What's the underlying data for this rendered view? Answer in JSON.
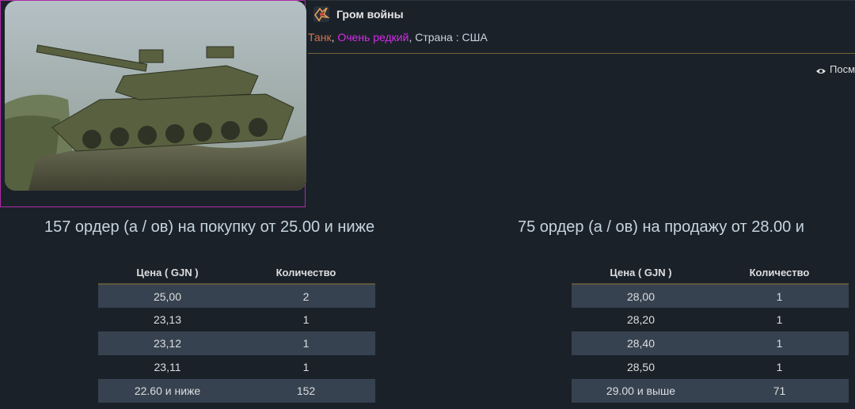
{
  "game": {
    "name": "Гром войны",
    "icon": "game-logo-icon"
  },
  "item": {
    "type": "Танк",
    "rarity": "Очень редкий",
    "country_label": "Страна : США",
    "image": "tank-image",
    "type_color": "#d2734a",
    "rarity_color": "#d32ce6"
  },
  "views": {
    "icon": "eye-icon",
    "label": "Посм"
  },
  "buy": {
    "title": "157 ордер (а / ов) на покупку от 25.00 и ниже",
    "columns": [
      "Цена ( GJN )",
      "Количество"
    ],
    "rows": [
      {
        "price": "25,00",
        "qty": "2"
      },
      {
        "price": "23,13",
        "qty": "1"
      },
      {
        "price": "23,12",
        "qty": "1"
      },
      {
        "price": "23,11",
        "qty": "1"
      },
      {
        "price": "22.60 и ниже",
        "qty": "152"
      }
    ]
  },
  "sell": {
    "title": "75 ордер (а / ов) на продажу от 28.00 и",
    "columns": [
      "Цена ( GJN )",
      "Количество"
    ],
    "rows": [
      {
        "price": "28,00",
        "qty": "1"
      },
      {
        "price": "28,20",
        "qty": "1"
      },
      {
        "price": "28,40",
        "qty": "1"
      },
      {
        "price": "28,50",
        "qty": "1"
      },
      {
        "price": "29.00 и выше",
        "qty": "71"
      }
    ]
  }
}
